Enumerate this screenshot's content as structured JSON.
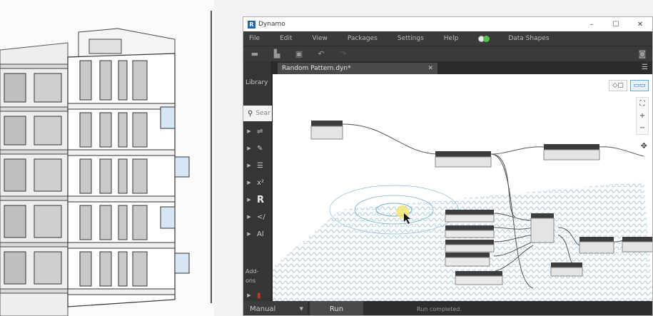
{
  "window": {
    "title": "Dynamo",
    "logo_letter": "R",
    "minimize": "–",
    "maximize": "☐",
    "close": "✕"
  },
  "menu": {
    "items": [
      "File",
      "Edit",
      "View",
      "Packages",
      "Settings",
      "Help"
    ],
    "extra": "Data Shapes"
  },
  "toolbar": {
    "icons": [
      "new-file-icon",
      "open-file-icon",
      "save-icon",
      "undo-icon",
      "redo-icon"
    ],
    "screenshot_icon": "camera-icon"
  },
  "library": {
    "title": "Library",
    "search_placeholder": "Sear",
    "rows": [
      {
        "glyph": "⇌"
      },
      {
        "glyph": "✎"
      },
      {
        "glyph": "☰"
      },
      {
        "glyph": "x²"
      },
      {
        "glyph": "R"
      },
      {
        "glyph": "</"
      },
      {
        "glyph": "Al"
      }
    ],
    "addons_line1": "Add-",
    "addons_line2": "ons",
    "last_row_glyph": "▮"
  },
  "tabs": [
    {
      "label": "Random Pattern.dyn*",
      "close": "✕"
    }
  ],
  "canvas": {
    "view_buttons": [
      "geometry-view-icon",
      "graph-view-icon"
    ],
    "zoom_controls": [
      "⛶",
      "+",
      "−"
    ],
    "pan": "✥"
  },
  "bottombar": {
    "run_mode": "Manual",
    "run_label": "Run",
    "status": "Run completed."
  },
  "colors": {
    "dynamo_dark": "#2d2d2d",
    "menubar": "#3a3a3a",
    "accent_green": "#55c24b",
    "revit_blue": "#1b67b0"
  }
}
